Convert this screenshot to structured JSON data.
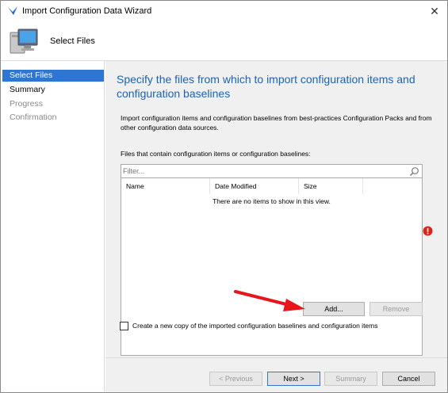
{
  "window": {
    "title": "Import Configuration Data Wizard",
    "close_glyph": "✕"
  },
  "header": {
    "title": "Select Files",
    "icon": "computer-icon"
  },
  "sidebar": {
    "items": [
      {
        "label": "Select Files",
        "state": "active"
      },
      {
        "label": "Summary",
        "state": "normal"
      },
      {
        "label": "Progress",
        "state": "disabled"
      },
      {
        "label": "Confirmation",
        "state": "disabled"
      }
    ]
  },
  "main": {
    "heading": "Specify the files from which to import configuration items and configuration baselines",
    "description": "Import configuration items and configuration baselines from best-practices Configuration Packs and from other configuration data sources.",
    "files_label": "Files that contain configuration items or configuration baselines:",
    "filter_placeholder": "Filter...",
    "columns": [
      "Name",
      "Date Modified",
      "Size"
    ],
    "empty_message": "There are no items to show in this view.",
    "add_label": "Add...",
    "remove_label": "Remove",
    "checkbox_label": "Create a new copy of the imported configuration baselines and configuration items",
    "checkbox_checked": false
  },
  "footer": {
    "previous_label": "< Previous",
    "next_label": "Next >",
    "summary_label": "Summary",
    "cancel_label": "Cancel"
  },
  "colors": {
    "accent": "#2f75d2",
    "heading": "#1b63b5",
    "annotation_arrow": "#e8161b",
    "error": "#d9261c"
  }
}
